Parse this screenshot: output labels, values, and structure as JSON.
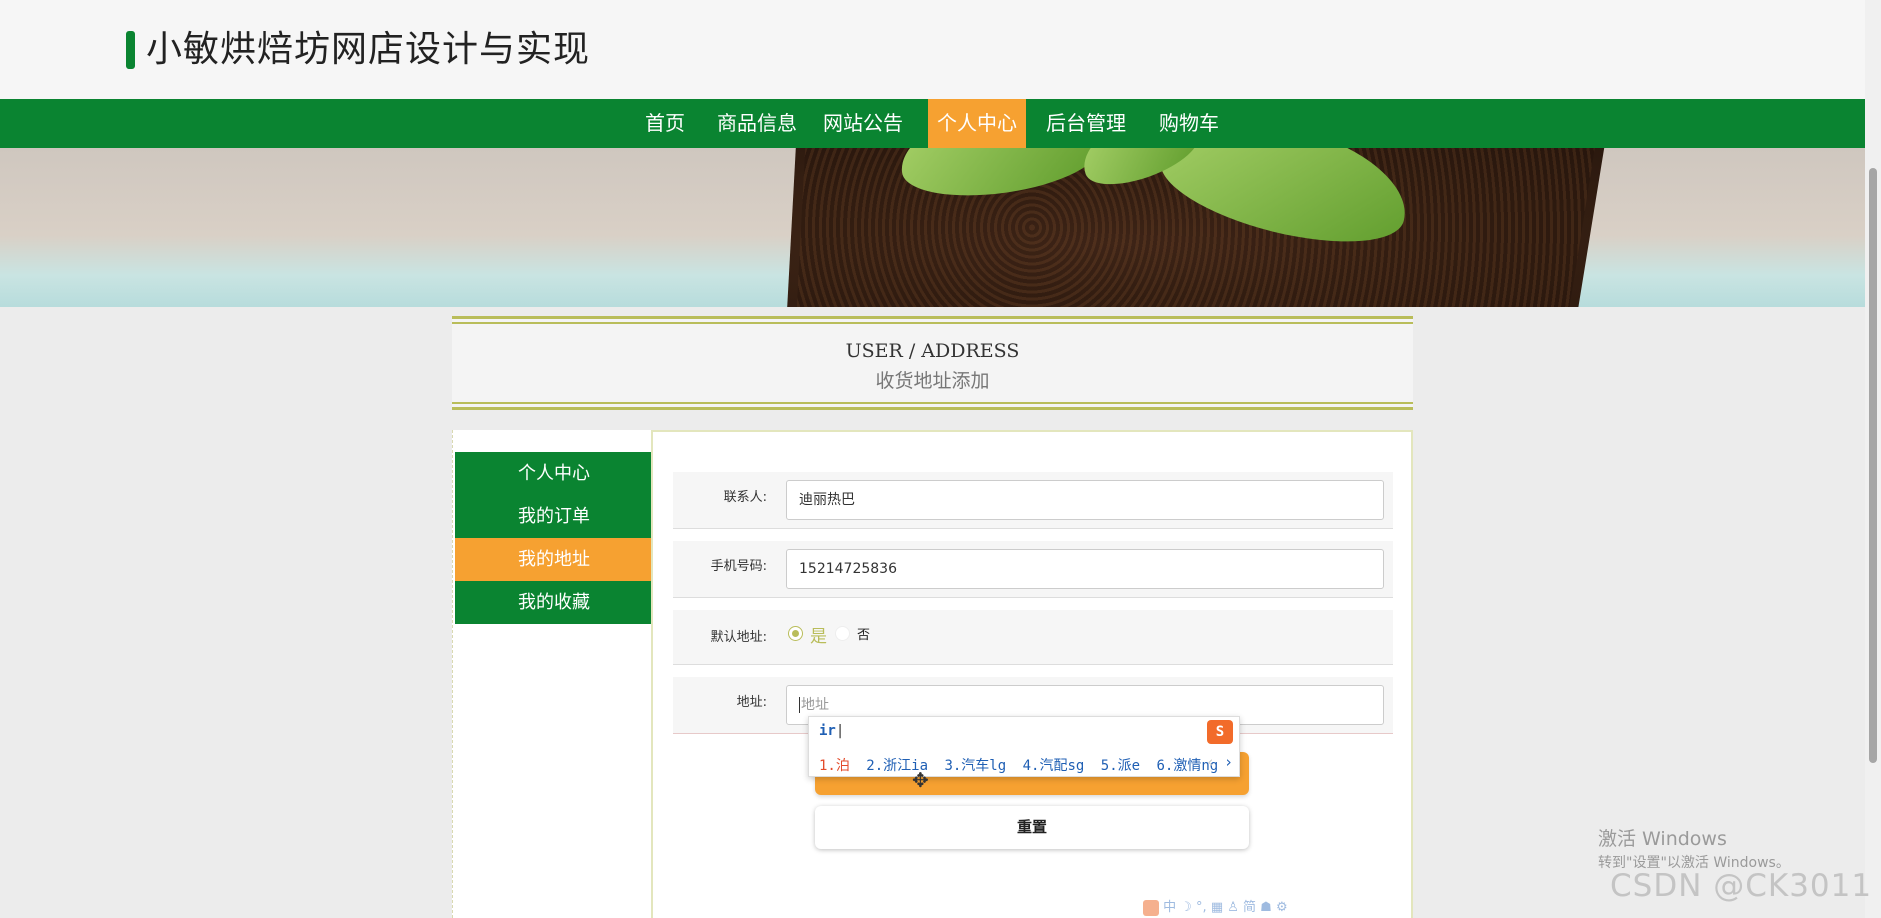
{
  "site": {
    "title": "小敏烘焙坊网店设计与实现"
  },
  "nav": {
    "items": [
      "首页",
      "商品信息",
      "网站公告",
      "个人中心",
      "后台管理",
      "购物车"
    ],
    "active": "个人中心"
  },
  "section": {
    "heading_en": "USER / ADDRESS",
    "heading_cn": "收货地址添加"
  },
  "sidebar": {
    "items": [
      "个人中心",
      "我的订单",
      "我的地址",
      "我的收藏"
    ],
    "active": "我的地址"
  },
  "form": {
    "contact": {
      "label": "联系人:",
      "value": "迪丽热巴"
    },
    "phone": {
      "label": "手机号码:",
      "value": "15214725836"
    },
    "default": {
      "label": "默认地址:",
      "yes": "是",
      "no": "否",
      "selected": "是"
    },
    "address": {
      "label": "地址:",
      "placeholder": "地址"
    },
    "reset_label": "重置"
  },
  "ime": {
    "input": "ir",
    "candidates": [
      "1.泊",
      "2.浙江ia",
      "3.汽车lg",
      "4.汽配sg",
      "5.派e",
      "6.激情ng"
    ]
  },
  "watermark": {
    "windows_title": "激活 Windows",
    "windows_sub": "转到\"设置\"以激活 Windows。",
    "csdn": "CSDN @CK3011"
  },
  "ime_toolbar": "中 ☽ °, ▦ ♙ 简 ☗ ⚙",
  "colors": {
    "primary": "#0a8431",
    "accent": "#f6a131",
    "line": "#b9bd5a"
  }
}
